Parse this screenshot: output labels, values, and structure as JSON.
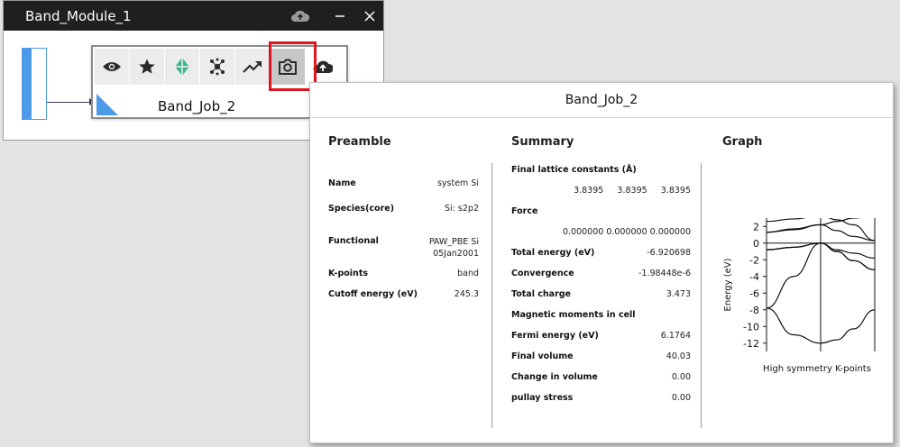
{
  "module_window": {
    "title": "Band_Module_1",
    "icons": [
      "cloud-icon",
      "minimize-icon",
      "close-icon"
    ]
  },
  "job_card": {
    "label": "Band_Job_2",
    "toolbar": [
      {
        "name": "view",
        "icon": "eye-icon"
      },
      {
        "name": "favorite",
        "icon": "star-icon"
      },
      {
        "name": "structure",
        "icon": "crystal-icon"
      },
      {
        "name": "molecule",
        "icon": "molecule-icon"
      },
      {
        "name": "trend",
        "icon": "trend-icon"
      },
      {
        "name": "snapshot",
        "icon": "camera-icon",
        "selected": true
      },
      {
        "name": "upload",
        "icon": "cloud-upload-icon"
      }
    ]
  },
  "report": {
    "title": "Band_Job_2",
    "preamble": {
      "heading": "Preamble",
      "rows": [
        {
          "label": "Name",
          "value": "system Si"
        },
        {
          "label": "Species(core)",
          "value": "Si: s2p2"
        },
        {
          "label": "Functional",
          "value": "PAW_PBE Si\n05Jan2001"
        },
        {
          "label": "K-points",
          "value": "band"
        },
        {
          "label": "Cutoff energy (eV)",
          "value": "245.3"
        }
      ]
    },
    "summary": {
      "heading": "Summary",
      "rows": [
        {
          "label": "Final lattice constants (Å)",
          "value": ""
        },
        {
          "label": "",
          "value": "3.8395     3.8395     3.8395"
        },
        {
          "label": "Force",
          "value": ""
        },
        {
          "label": "",
          "value": "0.000000 0.000000 0.000000"
        },
        {
          "label": "Total energy (eV)",
          "value": "-6.920698"
        },
        {
          "label": "Convergence",
          "value": "-1.98448e-6"
        },
        {
          "label": "Total charge",
          "value": "3.473"
        },
        {
          "label": "Magnetic moments in cell",
          "value": ""
        },
        {
          "label": "Fermi energy (eV)",
          "value": "6.1764"
        },
        {
          "label": "Final volume",
          "value": "40.03"
        },
        {
          "label": "Change in volume",
          "value": "0.00"
        },
        {
          "label": "pullay stress",
          "value": "0.00"
        }
      ]
    },
    "graph": {
      "heading": "Graph"
    }
  },
  "chart_data": {
    "type": "line",
    "xlabel": "High symmetry K-points",
    "ylabel": "Energy (eV)",
    "ylim": [
      -13,
      3
    ],
    "yticks": [
      2,
      0,
      -2,
      -4,
      -6,
      -8,
      -10,
      -12
    ],
    "x": [
      0,
      0.25,
      0.5,
      0.65,
      0.8,
      1.0
    ],
    "vertical_lines": [
      0.5,
      1.0
    ],
    "horizontal_line": 0,
    "series": [
      {
        "values": [
          -7.8,
          -11.0,
          -12.0,
          -11.6,
          -10.3,
          -8.0
        ]
      },
      {
        "values": [
          -7.8,
          -4.0,
          0.0,
          -1.0,
          -2.1,
          -3.2
        ]
      },
      {
        "values": [
          -0.8,
          -0.5,
          0.0,
          -1.0,
          -2.1,
          -3.2
        ]
      },
      {
        "values": [
          -0.8,
          -0.5,
          0.0,
          -0.8,
          -1.2,
          -1.8
        ]
      },
      {
        "values": [
          1.3,
          1.6,
          2.2,
          1.5,
          0.8,
          0.3
        ]
      },
      {
        "values": [
          1.3,
          1.7,
          2.2,
          2.6,
          3.0,
          3.3
        ]
      },
      {
        "values": [
          2.6,
          2.9,
          3.3,
          2.8,
          2.2,
          0.3
        ]
      }
    ]
  }
}
